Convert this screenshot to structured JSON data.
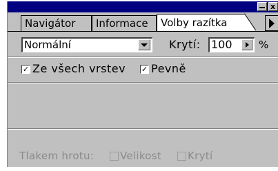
{
  "tabs": [
    {
      "label": "Navigátor"
    },
    {
      "label": "Informace"
    },
    {
      "label": "Volby razítka"
    }
  ],
  "titlebar": {
    "close_glyph": "x"
  },
  "blend_mode": {
    "value": "Normální"
  },
  "opacity": {
    "label": "Krytí:",
    "value": "100",
    "unit": "%"
  },
  "options": {
    "all_layers": {
      "label": "Ze všech vrstev",
      "checked": true
    },
    "aligned": {
      "label": "Pevně",
      "checked": true
    }
  },
  "stylus": {
    "label": "Tlakem hrotu:",
    "size": {
      "label": "Velikost",
      "checked": false
    },
    "opacity": {
      "label": "Krytí",
      "checked": false
    }
  },
  "check_glyph": "✓",
  "colors": {
    "titlebar": "#000080",
    "panel": "#c0c0c0",
    "disabled_text": "#8a8a8a"
  }
}
